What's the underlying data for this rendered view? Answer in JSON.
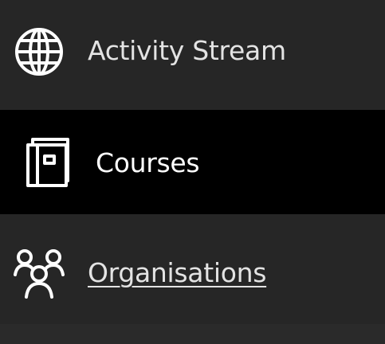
{
  "nav": {
    "items": [
      {
        "label": "Activity Stream",
        "icon": "globe-icon",
        "active": false
      },
      {
        "label": "Courses",
        "icon": "book-icon",
        "active": true
      },
      {
        "label": "Organisations",
        "icon": "people-group-icon",
        "active": false,
        "underlined": true
      }
    ]
  },
  "colors": {
    "item_background": "#262626",
    "active_background": "#000000",
    "text": "#e3e3e3",
    "active_text": "#ffffff",
    "icon": "#ffffff"
  }
}
